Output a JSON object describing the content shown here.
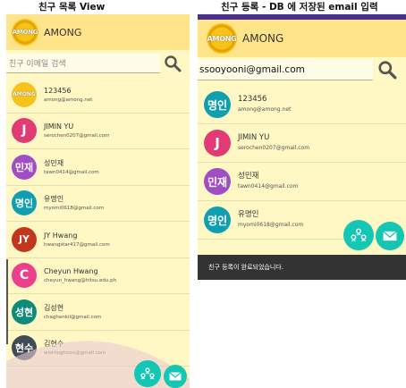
{
  "captions": {
    "left": "친구 목록 View",
    "right": "친구 등록 - DB 에 저장된 email 입력"
  },
  "left_screen": {
    "app_title": "AMONG",
    "logo_text": "AMONG",
    "search_placeholder": "친구 이메일 검색",
    "search_value": "",
    "friends": [
      {
        "avatar_text": "AMONG",
        "avatar_color": "#f7c31a",
        "name": "123456",
        "email": "among@among.net",
        "is_logo": true
      },
      {
        "avatar_text": "J",
        "avatar_color": "#e23a73",
        "name": "JIMIN YU",
        "email": "serochen0207@gmail.com"
      },
      {
        "avatar_text": "민재",
        "avatar_color": "#a14dc3",
        "name": "성민재",
        "email": "tawn0414@gmail.com"
      },
      {
        "avatar_text": "명인",
        "avatar_color": "#0f9fb1",
        "name": "유명인",
        "email": "myomi0618@gmail.com"
      },
      {
        "avatar_text": "JY",
        "avatar_color": "#c2361b",
        "name": "JY Hwang",
        "email": "hwangstar417@gmail.com"
      },
      {
        "avatar_text": "C",
        "avatar_color": "#ec3f8c",
        "name": "Cheyun Hwang",
        "email": "cheyun_hwang@hitsu.edu.ph"
      },
      {
        "avatar_text": "성현",
        "avatar_color": "#0e8c77",
        "name": "김성현",
        "email": "chaghenkil@gmail.com"
      },
      {
        "avatar_text": "현수",
        "avatar_color": "#3f4b56",
        "name": "김현수",
        "email": "wishtoghoon@gmail.com"
      }
    ]
  },
  "right_screen": {
    "app_title": "AMONG",
    "logo_text": "AMONG",
    "search_value": "ssooyooni@gmail.com",
    "friends": [
      {
        "avatar_text": "명인",
        "avatar_color": "#0f9fb1",
        "name": "123456",
        "email": "among@among.net"
      },
      {
        "avatar_text": "J",
        "avatar_color": "#e23a73",
        "name": "JIMIN YU",
        "email": "serochen0207@gmail.com"
      },
      {
        "avatar_text": "민재",
        "avatar_color": "#a14dc3",
        "name": "성민재",
        "email": "tawn0414@gmail.com"
      },
      {
        "avatar_text": "명인",
        "avatar_color": "#0f9fb1",
        "name": "유명인",
        "email": "myomi0618@gmail.com"
      }
    ],
    "toast": "친구 등록이 완료되었습니다."
  },
  "colors": {
    "fab": "#14c6b4",
    "appbar": "#ffe48a",
    "background": "#fff7c4"
  }
}
